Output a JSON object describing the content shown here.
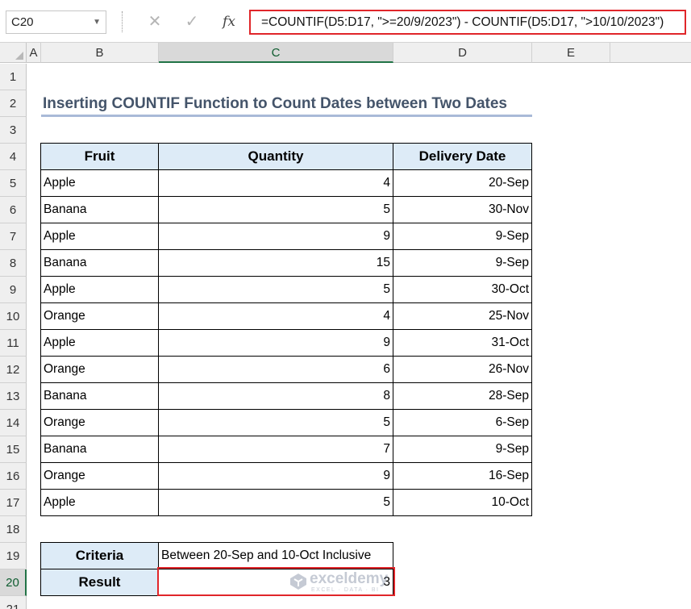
{
  "formula_bar": {
    "name_box": "C20",
    "cancel_icon": "✕",
    "enter_icon": "✓",
    "fx_label": "fx",
    "formula": "=COUNTIF(D5:D17, \">=20/9/2023\") - COUNTIF(D5:D17, \">10/10/2023\")"
  },
  "columns": [
    "A",
    "B",
    "C",
    "D",
    "E"
  ],
  "rows": [
    "1",
    "2",
    "3",
    "4",
    "5",
    "6",
    "7",
    "8",
    "9",
    "10",
    "11",
    "12",
    "13",
    "14",
    "15",
    "16",
    "17",
    "18",
    "19",
    "20",
    "21"
  ],
  "title": "Inserting COUNTIF Function to Count Dates between Two Dates",
  "table": {
    "headers": [
      "Fruit",
      "Quantity",
      "Delivery Date"
    ],
    "rows": [
      [
        "Apple",
        "4",
        "20-Sep"
      ],
      [
        "Banana",
        "5",
        "30-Nov"
      ],
      [
        "Apple",
        "9",
        "9-Sep"
      ],
      [
        "Banana",
        "15",
        "9-Sep"
      ],
      [
        "Apple",
        "5",
        "30-Oct"
      ],
      [
        "Orange",
        "4",
        "25-Nov"
      ],
      [
        "Apple",
        "9",
        "31-Oct"
      ],
      [
        "Orange",
        "6",
        "26-Nov"
      ],
      [
        "Banana",
        "8",
        "28-Sep"
      ],
      [
        "Orange",
        "5",
        "6-Sep"
      ],
      [
        "Banana",
        "7",
        "9-Sep"
      ],
      [
        "Orange",
        "9",
        "16-Sep"
      ],
      [
        "Apple",
        "5",
        "10-Oct"
      ]
    ]
  },
  "summary": {
    "criteria_label": "Criteria",
    "criteria_value": "Between 20-Sep and 10-Oct Inclusive",
    "result_label": "Result",
    "result_value": "3"
  },
  "watermark": {
    "name": "exceldemy",
    "tagline": "EXCEL · DATA · BI"
  },
  "colors": {
    "header_fill": "#ddebf7",
    "highlight_border": "#e0262a",
    "title_color": "#44546a",
    "selection_green": "#217346"
  }
}
